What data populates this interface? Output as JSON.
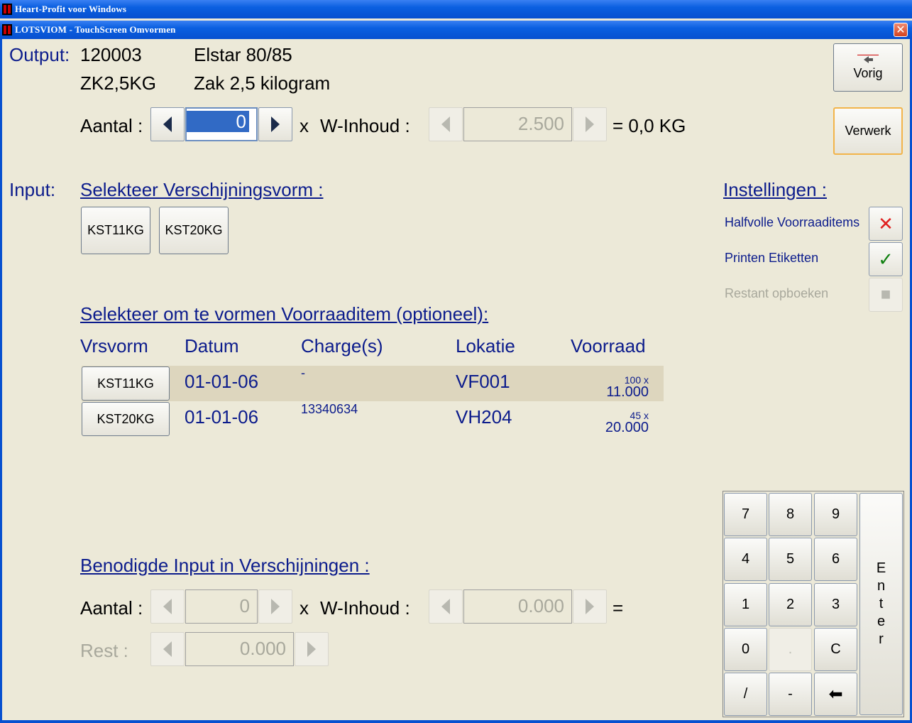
{
  "window": {
    "app_title": "Heart-Profit voor Windows",
    "dialog_title": "LOTSVIOM - TouchScreen Omvormen",
    "close_label": "✕"
  },
  "output": {
    "label": "Output:",
    "code": "120003",
    "name": "Elstar 80/85",
    "package_code": "ZK2,5KG",
    "package_name": "Zak 2,5 kilogram",
    "aantal_label": "Aantal :",
    "aantal_value": "0",
    "x_label": "x",
    "winhoud_label": "W-Inhoud :",
    "winhoud_value": "2.500",
    "result": "= 0,0 KG"
  },
  "buttons": {
    "vorig": "Vorig",
    "verwerk": "Verwerk"
  },
  "input": {
    "label": "Input:",
    "select_form_title": "Selekteer Verschijningsvorm :",
    "forms": [
      "KST11KG",
      "KST20KG"
    ],
    "select_item_title": "Selekteer om te vormen Voorraaditem (optioneel):",
    "columns": [
      "Vrsvorm",
      "Datum",
      "Charge(s)",
      "Lokatie",
      "Voorraad"
    ],
    "rows": [
      {
        "vrsvorm": "KST11KG",
        "datum": "01-01-06",
        "charge": "-",
        "lokatie": "VF001",
        "voorraad_count": "100 x",
        "voorraad_qty": "11.000"
      },
      {
        "vrsvorm": "KST20KG",
        "datum": "01-01-06",
        "charge": "13340634",
        "lokatie": "VH204",
        "voorraad_count": "45 x",
        "voorraad_qty": "20.000"
      }
    ]
  },
  "settings": {
    "title": "Instellingen :",
    "items": [
      {
        "label": "Halfvolle Voorraaditems",
        "state": "✕",
        "color": "#E02020"
      },
      {
        "label": "Printen Etiketten",
        "state": "✓",
        "color": "#108010"
      },
      {
        "label": "Restant opboeken",
        "state": "■",
        "color": "#B8B8B0"
      }
    ]
  },
  "required": {
    "title": "Benodigde Input in Verschijningen :",
    "aantal_label": "Aantal :",
    "aantal_value": "0",
    "x_label": "x",
    "winhoud_label": "W-Inhoud :",
    "winhoud_value": "0.000",
    "equals": "=",
    "rest_label": "Rest :",
    "rest_value": "0.000"
  },
  "keypad": {
    "keys": [
      "7",
      "8",
      "9",
      "4",
      "5",
      "6",
      "1",
      "2",
      "3",
      "0",
      ".",
      "C",
      "/",
      "-",
      "⬅"
    ],
    "enter": [
      "E",
      "n",
      "t",
      "e",
      "r"
    ]
  }
}
